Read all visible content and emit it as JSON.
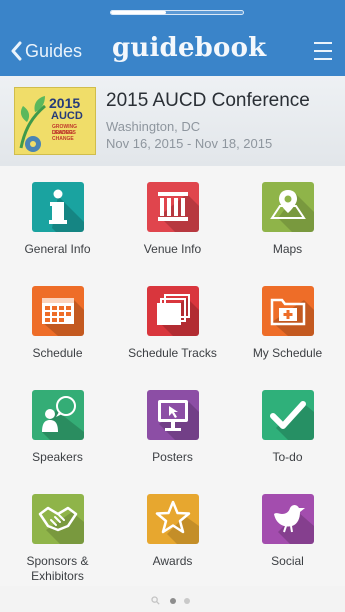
{
  "status_bar": {
    "progress": 0.42
  },
  "nav": {
    "back_label": "Guides",
    "brand": "guidebook"
  },
  "event": {
    "logo_year": "2015",
    "logo_org": "AUCD",
    "logo_tag1": "GROWING LEADERS",
    "logo_tag2": "DRIVING CHANGE",
    "title": "2015 AUCD Conference",
    "location": "Washington, DC",
    "dates": "Nov 16, 2015 - Nov 18, 2015"
  },
  "tiles": [
    {
      "label": "General Info",
      "icon": "info-icon",
      "color": "#1aa3a0"
    },
    {
      "label": "Venue Info",
      "icon": "building-columns-icon",
      "color": "#e0454d"
    },
    {
      "label": "Maps",
      "icon": "map-pin-icon",
      "color": "#8fb449"
    },
    {
      "label": "Schedule",
      "icon": "calendar-icon",
      "color": "#ee6d28"
    },
    {
      "label": "Schedule Tracks",
      "icon": "folders-icon",
      "color": "#d9363d"
    },
    {
      "label": "My Schedule",
      "icon": "folder-plus-icon",
      "color": "#ee6d28"
    },
    {
      "label": "Speakers",
      "icon": "speaker-bubble-icon",
      "color": "#34ad76"
    },
    {
      "label": "Posters",
      "icon": "poster-board-icon",
      "color": "#8c4ea5"
    },
    {
      "label": "To-do",
      "icon": "checkmark-icon",
      "color": "#2fb07a"
    },
    {
      "label": "Sponsors & Exhibitors",
      "icon": "handshake-icon",
      "color": "#8fb449"
    },
    {
      "label": "Awards",
      "icon": "star-icon",
      "color": "#e7a72f"
    },
    {
      "label": "Social",
      "icon": "bird-icon",
      "color": "#a34dae"
    }
  ],
  "pager": {
    "pages": 2,
    "current": 1
  },
  "colors": {
    "nav": "#3a84c9"
  }
}
